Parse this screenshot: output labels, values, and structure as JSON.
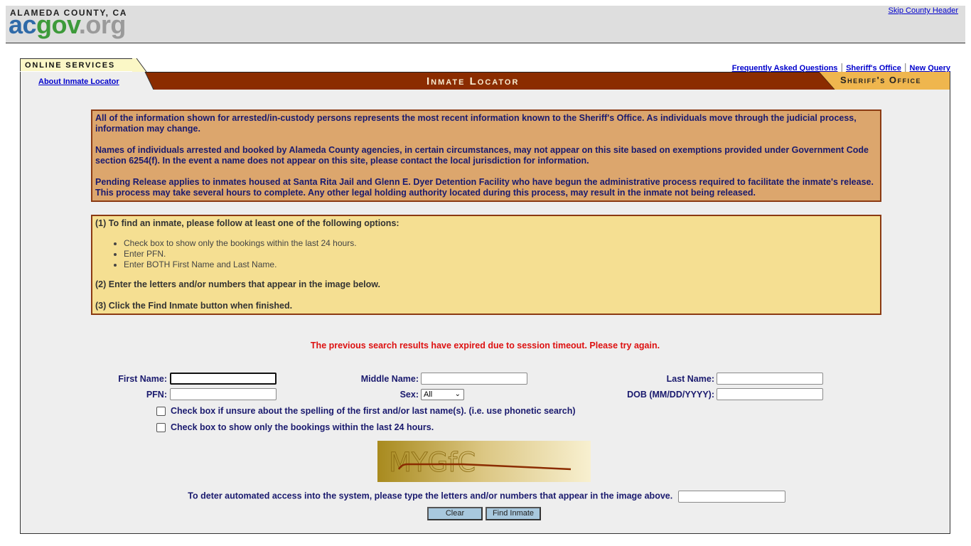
{
  "county_header": {
    "county_name": "ALAMEDA COUNTY, CA",
    "logo": {
      "ac": "ac",
      "gov": "gov",
      "org": ".org"
    },
    "skip_link": "Skip County Header"
  },
  "app": {
    "online_services_tab": "ONLINE SERVICES",
    "title": "Inmate Locator",
    "sheriff_tab": "Sheriff's Office",
    "about_link": "About Inmate Locator",
    "top_links": [
      {
        "label": "Frequently Asked Questions"
      },
      {
        "label": "Sheriff's Office"
      },
      {
        "label": "New Query"
      }
    ]
  },
  "notice": {
    "paragraphs": [
      "All of the information shown for arrested/in-custody persons represents the most recent information known to the Sheriff's Office.  As individuals move through the judicial process, information may change.",
      "Names of individuals arrested and booked by Alameda County agencies, in certain circumstances, may not appear on this site based on exemptions provided under Government Code section 6254(f).  In the event a name does not appear on this site, please contact the local jurisdiction for information.",
      "Pending Release applies to inmates housed at Santa Rita Jail and Glenn E. Dyer Detention Facility who have begun the administrative process required to facilitate the inmate's release.  This process may take several hours to complete.  Any other legal holding authority located during this process, may result in the inmate not being released."
    ]
  },
  "instructions": {
    "step1": "(1) To find an inmate, please follow at least one of the following options:",
    "options": [
      "Check box to show only the bookings within the last 24 hours.",
      "Enter PFN.",
      "Enter BOTH First Name and Last Name."
    ],
    "step2": "(2) Enter the letters and/or numbers that appear in the image below.",
    "step3": "(3) Click the Find Inmate button when finished."
  },
  "error_message": "The previous search results have expired due to session timeout.  Please try again.",
  "form": {
    "first_name": {
      "label": "First Name:",
      "value": ""
    },
    "middle_name": {
      "label": "Middle Name:",
      "value": ""
    },
    "last_name": {
      "label": "Last Name:",
      "value": ""
    },
    "pfn": {
      "label": "PFN:",
      "value": ""
    },
    "sex": {
      "label": "Sex:",
      "selected": "All"
    },
    "dob": {
      "label": "DOB (MM/DD/YYYY):",
      "value": ""
    },
    "phonetic_checkbox": {
      "label": "Check box if unsure about the spelling of the first and/or last name(s). (i.e. use phonetic search)",
      "checked": false
    },
    "last24_checkbox": {
      "label": "Check box to show only the bookings within the last 24 hours.",
      "checked": false
    },
    "captcha_text": "MYGfC",
    "captcha_label": "To deter automated access into the system, please type the letters and/or numbers that appear in the image above.",
    "captcha_value": "",
    "clear_button": "Clear",
    "find_button": "Find Inmate"
  },
  "colors": {
    "title_bar": "#8b2c00",
    "notice_bg": "#dca66d",
    "instructions_bg": "#f5df92",
    "error": "#dd1111",
    "label_text": "#1a1a6e",
    "button_bg": "#a8c8de"
  }
}
